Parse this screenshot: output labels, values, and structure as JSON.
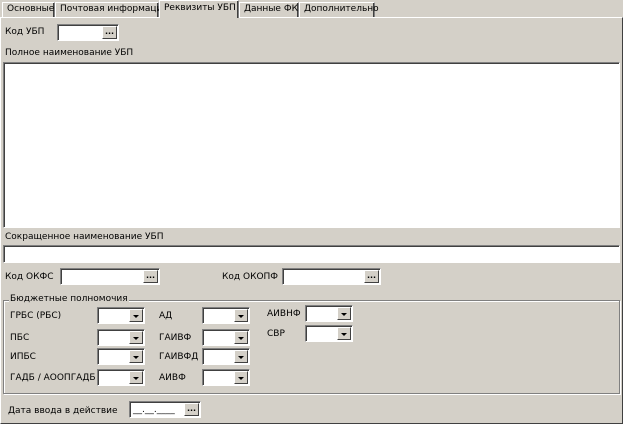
{
  "tabs": [
    {
      "label": "Основные"
    },
    {
      "label": "Почтовая информация"
    },
    {
      "label": "Реквизиты УБП"
    },
    {
      "label": "Данные ФК"
    },
    {
      "label": "Дополнительно"
    }
  ],
  "ubp_code": {
    "label": "Код УБП",
    "value": "",
    "ellipsis": "..."
  },
  "full_name": {
    "label": "Полное наименование УБП",
    "value": ""
  },
  "short_name": {
    "label": "Сокращенное наименование УБП",
    "value": ""
  },
  "okfs": {
    "label": "Код ОКФС",
    "value": "",
    "ellipsis": "..."
  },
  "okopf": {
    "label": "Код ОКОПФ",
    "value": "",
    "ellipsis": "..."
  },
  "budget": {
    "title": "Бюджетные полномочия",
    "grbs": "ГРБС (РБС)",
    "pbs": "ПБС",
    "ipbs": "ИПБС",
    "gadb": "ГАДБ / АООПГАДБ",
    "ad": "АД",
    "gaivf": "ГАИВФ",
    "gaivfd": "ГАИВФД",
    "aivf": "АИВФ",
    "aivnf": "АИВНФ",
    "svr": "СВР"
  },
  "effective_date": {
    "label": "Дата ввода в действие",
    "value": "__.__.____",
    "ellipsis": "..."
  }
}
